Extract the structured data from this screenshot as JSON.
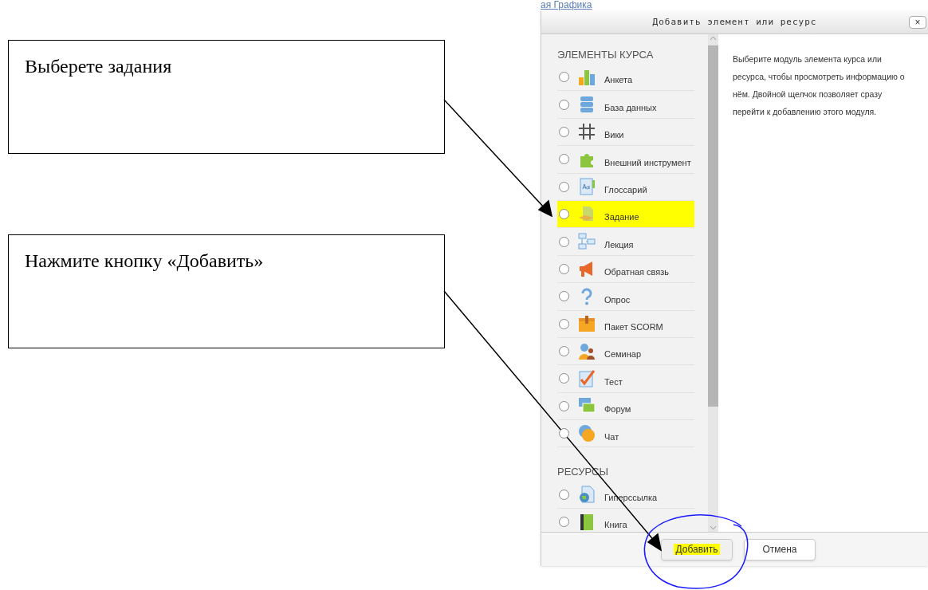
{
  "background_link": "ая Графика",
  "callouts": [
    {
      "text": "Выберете задания"
    },
    {
      "text": "Нажмите кнопку «Добавить»"
    }
  ],
  "dialog": {
    "title": "Добавить элемент или ресурс",
    "close": "×",
    "sections": [
      {
        "heading": "ЭЛЕМЕНТЫ КУРСА",
        "items": [
          {
            "label": "Анкета",
            "selected": false,
            "highlighted": false
          },
          {
            "label": "База данных",
            "selected": false,
            "highlighted": false
          },
          {
            "label": "Вики",
            "selected": false,
            "highlighted": false
          },
          {
            "label": "Внешний инструмент",
            "selected": false,
            "highlighted": false
          },
          {
            "label": "Глоссарий",
            "selected": false,
            "highlighted": false
          },
          {
            "label": "Задание",
            "selected": false,
            "highlighted": true
          },
          {
            "label": "Лекция",
            "selected": false,
            "highlighted": false
          },
          {
            "label": "Обратная связь",
            "selected": false,
            "highlighted": false
          },
          {
            "label": "Опрос",
            "selected": false,
            "highlighted": false
          },
          {
            "label": "Пакет SCORM",
            "selected": false,
            "highlighted": false
          },
          {
            "label": "Семинар",
            "selected": false,
            "highlighted": false
          },
          {
            "label": "Тест",
            "selected": false,
            "highlighted": false
          },
          {
            "label": "Форум",
            "selected": false,
            "highlighted": false
          },
          {
            "label": "Чат",
            "selected": false,
            "highlighted": false
          }
        ]
      },
      {
        "heading": "РЕСУРСЫ",
        "items": [
          {
            "label": "Гиперссылка",
            "selected": false,
            "highlighted": false
          },
          {
            "label": "Книга",
            "selected": false,
            "highlighted": false
          }
        ]
      }
    ],
    "description": "Выберите модуль элемента курса или ресурса, чтобы просмотреть информацию о нём. Двойной щелчок позволяет сразу перейти к добавлению этого модуля.",
    "buttons": [
      {
        "label": "Добавить",
        "highlighted": true
      },
      {
        "label": "Отмена",
        "highlighted": false
      }
    ]
  }
}
